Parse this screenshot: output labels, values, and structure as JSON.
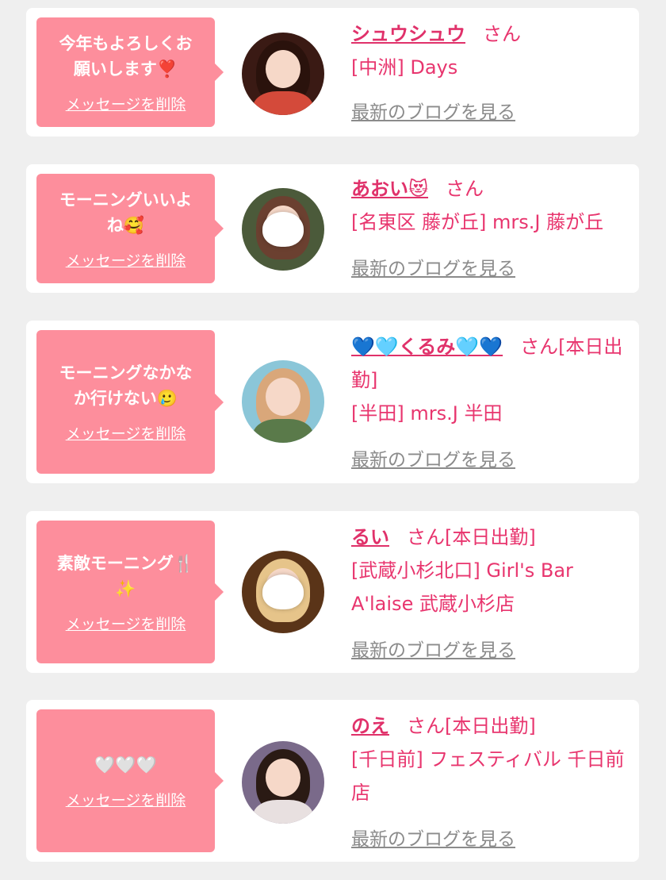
{
  "items": [
    {
      "message": "今年もよろしくお\n願いします❣️",
      "delete_label": "メッセージを削除",
      "name": "シュウシュウ",
      "honorific": "さん",
      "status": "",
      "store": "[中洲] Days",
      "blog_label": "最新のブログを見る"
    },
    {
      "message": "モーニングいいよ\nね🥰",
      "delete_label": "メッセージを削除",
      "name": "あおい😻",
      "honorific": "さん",
      "status": "",
      "store": "[名東区 藤が丘] mrs.J 藤が丘",
      "blog_label": "最新のブログを見る"
    },
    {
      "message": "モーニングなかな\nか行けない🥲",
      "delete_label": "メッセージを削除",
      "name": "💙🩵くるみ🩵💙",
      "honorific": "さん",
      "status": "[本日出勤]",
      "store": "[半田] mrs.J 半田",
      "blog_label": "最新のブログを見る"
    },
    {
      "message": "素敵モーニング🍴\n✨",
      "delete_label": "メッセージを削除",
      "name": "るい",
      "honorific": "さん",
      "status": "[本日出勤]",
      "store": "[武蔵小杉北口] Girl's Bar A'laise 武蔵小杉店",
      "blog_label": "最新のブログを見る"
    },
    {
      "message": "🤍🤍🤍",
      "delete_label": "メッセージを削除",
      "name": "のえ",
      "honorific": "さん",
      "status": "[本日出勤]",
      "store": "[千日前] フェスティバル 千日前店",
      "blog_label": "最新のブログを見る"
    }
  ],
  "colors": {
    "background": "#efefef",
    "card": "#ffffff",
    "bubble": "#fd8e9c",
    "accent": "#e0316a",
    "link_gray": "#8b8b8b"
  }
}
